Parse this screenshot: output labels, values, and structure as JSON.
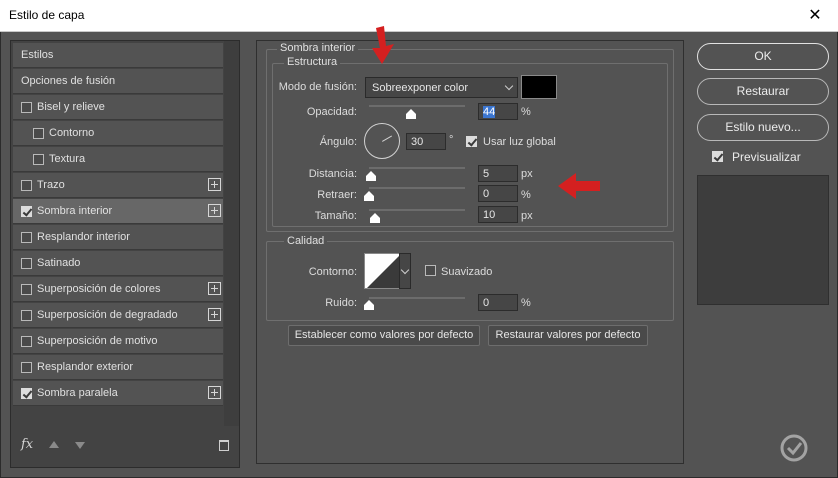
{
  "window": {
    "title": "Estilo de capa",
    "close_glyph": "✕"
  },
  "left_panel": {
    "items": [
      {
        "label": "Estilos",
        "checkbox": false,
        "checked": false,
        "indent": 0,
        "plus": false
      },
      {
        "label": "Opciones de fusión",
        "checkbox": false,
        "checked": false,
        "indent": 0,
        "plus": false
      },
      {
        "label": "Bisel y relieve",
        "checkbox": true,
        "checked": false,
        "indent": 0,
        "plus": false
      },
      {
        "label": "Contorno",
        "checkbox": true,
        "checked": false,
        "indent": 1,
        "plus": false
      },
      {
        "label": "Textura",
        "checkbox": true,
        "checked": false,
        "indent": 1,
        "plus": false
      },
      {
        "label": "Trazo",
        "checkbox": true,
        "checked": false,
        "indent": 0,
        "plus": true
      },
      {
        "label": "Sombra interior",
        "checkbox": true,
        "checked": true,
        "indent": 0,
        "plus": true,
        "selected": true
      },
      {
        "label": "Resplandor interior",
        "checkbox": true,
        "checked": false,
        "indent": 0,
        "plus": false
      },
      {
        "label": "Satinado",
        "checkbox": true,
        "checked": false,
        "indent": 0,
        "plus": false
      },
      {
        "label": "Superposición de colores",
        "checkbox": true,
        "checked": false,
        "indent": 0,
        "plus": true
      },
      {
        "label": "Superposición de degradado",
        "checkbox": true,
        "checked": false,
        "indent": 0,
        "plus": true
      },
      {
        "label": "Superposición de motivo",
        "checkbox": true,
        "checked": false,
        "indent": 0,
        "plus": false
      },
      {
        "label": "Resplandor exterior",
        "checkbox": true,
        "checked": false,
        "indent": 0,
        "plus": false
      },
      {
        "label": "Sombra paralela",
        "checkbox": true,
        "checked": true,
        "indent": 0,
        "plus": true
      }
    ],
    "footer": {
      "fx_label": "fx"
    }
  },
  "inner_shadow": {
    "section_title": "Sombra interior",
    "structure": {
      "title": "Estructura",
      "blend_mode": {
        "label": "Modo de fusión:",
        "value": "Sobreexponer color"
      },
      "color_swatch": "#000000",
      "opacity": {
        "label": "Opacidad:",
        "value": "44",
        "unit": "%",
        "fraction": 0.44
      },
      "angle": {
        "label": "Ángulo:",
        "value": "30",
        "unit": "°",
        "global_light_label": "Usar luz global",
        "global_light_checked": true
      },
      "distance": {
        "label": "Distancia:",
        "value": "5",
        "unit": "px",
        "fraction": 0.02
      },
      "choke": {
        "label": "Retraer:",
        "value": "0",
        "unit": "%",
        "fraction": 0.0
      },
      "size": {
        "label": "Tamaño:",
        "value": "10",
        "unit": "px",
        "fraction": 0.06
      }
    },
    "quality": {
      "title": "Calidad",
      "contour": {
        "label": "Contorno:",
        "smooth_label": "Suavizado",
        "smooth_checked": false
      },
      "noise": {
        "label": "Ruido:",
        "value": "0",
        "unit": "%",
        "fraction": 0.0
      }
    },
    "buttons": {
      "make_default": "Establecer como valores por defecto",
      "reset_default": "Restaurar valores por defecto"
    }
  },
  "right_panel": {
    "ok": "OK",
    "reset": "Restaurar",
    "new_style": "Estilo nuevo...",
    "preview_label": "Previsualizar",
    "preview_checked": true
  },
  "colors": {
    "annotation_arrow": "#d42020",
    "highlight": "#3b76d1"
  }
}
